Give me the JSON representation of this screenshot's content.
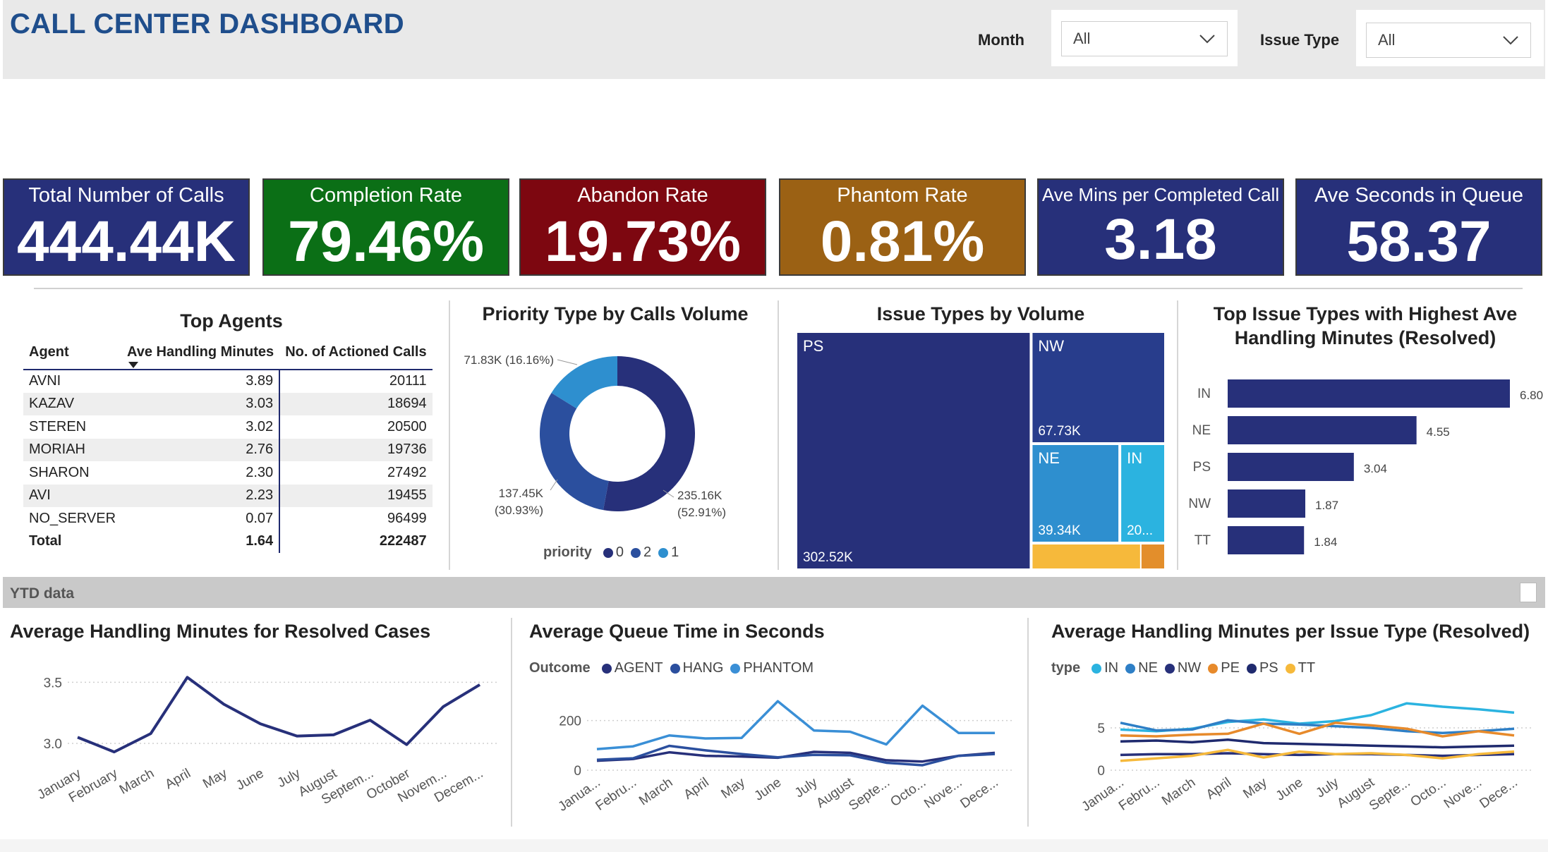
{
  "header": {
    "title": "CALL CENTER DASHBOARD",
    "filters": [
      {
        "label": "Month",
        "value": "All"
      },
      {
        "label": "Issue Type",
        "value": "All"
      }
    ]
  },
  "kpis": [
    {
      "title": "Total Number of Calls",
      "value": "444.44K",
      "color": "#27307a"
    },
    {
      "title": "Completion Rate",
      "value": "79.46%",
      "color": "#0b6f16"
    },
    {
      "title": "Abandon Rate",
      "value": "19.73%",
      "color": "#7d0710"
    },
    {
      "title": "Phantom Rate",
      "value": "0.81%",
      "color": "#9b6114"
    },
    {
      "title": "Ave Mins per Completed Call",
      "value": "3.18",
      "color": "#27307a"
    },
    {
      "title": "Ave Seconds in Queue",
      "value": "58.37",
      "color": "#27307a"
    }
  ],
  "top_agents": {
    "title": "Top Agents",
    "columns": [
      "Agent",
      "Ave Handling Minutes",
      "No. of Actioned Calls"
    ],
    "rows": [
      [
        "AVNI",
        "3.89",
        "20111"
      ],
      [
        "KAZAV",
        "3.03",
        "18694"
      ],
      [
        "STEREN",
        "3.02",
        "20500"
      ],
      [
        "MORIAH",
        "2.76",
        "19736"
      ],
      [
        "SHARON",
        "2.30",
        "27492"
      ],
      [
        "AVI",
        "2.23",
        "19455"
      ],
      [
        "NO_SERVER",
        "0.07",
        "96499"
      ]
    ],
    "total": [
      "Total",
      "1.64",
      "222487"
    ]
  },
  "ytd_label": "YTD data",
  "chart_data": [
    {
      "id": "priority",
      "type": "pie",
      "title": "Priority Type by Calls Volume",
      "legend_title": "priority",
      "slices": [
        {
          "name": "0",
          "value": 235.16,
          "label": "235.16K",
          "pct": "(52.91%)",
          "color": "#27307a"
        },
        {
          "name": "2",
          "value": 137.45,
          "label": "137.45K",
          "pct": "(30.93%)",
          "color": "#2b4f9e"
        },
        {
          "name": "1",
          "value": 71.83,
          "label": "71.83K (16.16%)",
          "pct": "",
          "color": "#2e8fcf"
        }
      ]
    },
    {
      "id": "issue_treemap",
      "type": "treemap",
      "title": "Issue Types by Volume",
      "items": [
        {
          "name": "PS",
          "value": 302.52,
          "label": "302.52K",
          "color": "#27307a"
        },
        {
          "name": "NW",
          "value": 67.73,
          "label": "67.73K",
          "color": "#283d8c"
        },
        {
          "name": "NE",
          "value": 39.34,
          "label": "39.34K",
          "color": "#2e8fcf"
        },
        {
          "name": "IN",
          "value": 20.0,
          "label": "20...",
          "color": "#2bb3e0"
        },
        {
          "name": "PE",
          "value": 12.0,
          "label": "",
          "color": "#f6b93b"
        },
        {
          "name": "TT",
          "value": 2.5,
          "label": "",
          "color": "#e38e2b"
        }
      ]
    },
    {
      "id": "top_issue_aht",
      "type": "bar",
      "orientation": "horizontal",
      "title": "Top Issue Types with Highest Ave Handling Minutes (Resolved)",
      "categories": [
        "IN",
        "NE",
        "PS",
        "NW",
        "TT"
      ],
      "values": [
        6.8,
        4.55,
        3.04,
        1.87,
        1.84
      ],
      "value_labels": [
        "6.80",
        "4.55",
        "3.04",
        "1.87",
        "1.84"
      ],
      "xlim": [
        0,
        6.8
      ],
      "color": "#27307a"
    },
    {
      "id": "aht_resolved",
      "type": "line",
      "title": "Average Handling Minutes for Resolved Cases",
      "categories": [
        "January",
        "February",
        "March",
        "April",
        "May",
        "June",
        "July",
        "August",
        "Septem...",
        "October",
        "Novem...",
        "Decem..."
      ],
      "series": [
        {
          "values": [
            3.05,
            2.93,
            3.08,
            3.54,
            3.32,
            3.16,
            3.06,
            3.07,
            3.19,
            2.99,
            3.3,
            3.48
          ],
          "color": "#27307a"
        }
      ],
      "yticks": [
        "3.0",
        "3.5"
      ],
      "ylim": [
        2.85,
        3.6
      ]
    },
    {
      "id": "queue_time",
      "type": "line",
      "title": "Average Queue Time in Seconds",
      "legend_title": "Outcome",
      "categories": [
        "Janua...",
        "Febru...",
        "March",
        "April",
        "May",
        "June",
        "July",
        "August",
        "Septe...",
        "Octo...",
        "Nove...",
        "Dece..."
      ],
      "series": [
        {
          "name": "AGENT",
          "values": [
            38,
            45,
            72,
            58,
            55,
            50,
            74,
            70,
            40,
            35,
            58,
            70
          ],
          "color": "#27307a"
        },
        {
          "name": "HANG",
          "values": [
            42,
            48,
            98,
            80,
            65,
            52,
            62,
            60,
            30,
            20,
            58,
            65
          ],
          "color": "#2b4f9e"
        },
        {
          "name": "PHANTOM",
          "values": [
            85,
            96,
            140,
            128,
            130,
            278,
            160,
            155,
            104,
            260,
            150,
            150
          ],
          "color": "#3a8fd6"
        }
      ],
      "yticks": [
        "0",
        "200"
      ],
      "ylim": [
        0,
        290
      ]
    },
    {
      "id": "aht_issue_type",
      "type": "line",
      "title": "Average Handling Minutes per Issue Type (Resolved)",
      "legend_title": "type",
      "categories": [
        "Janua...",
        "Febru...",
        "March",
        "April",
        "May",
        "June",
        "July",
        "August",
        "Septe...",
        "Octo...",
        "Nove...",
        "Dece..."
      ],
      "series": [
        {
          "name": "IN",
          "values": [
            4.8,
            4.6,
            4.9,
            5.7,
            6.0,
            5.5,
            5.8,
            6.5,
            7.9,
            7.5,
            7.2,
            6.8
          ],
          "color": "#2bb3e0"
        },
        {
          "name": "NE",
          "values": [
            5.6,
            4.7,
            4.8,
            5.9,
            5.5,
            5.4,
            5.2,
            5.0,
            4.6,
            4.4,
            4.6,
            4.9
          ],
          "color": "#2e7fc6"
        },
        {
          "name": "NW",
          "values": [
            1.8,
            1.9,
            1.9,
            2.0,
            1.9,
            1.8,
            1.9,
            1.9,
            1.8,
            1.7,
            1.8,
            1.9
          ],
          "color": "#27307a"
        },
        {
          "name": "PE",
          "values": [
            4.1,
            4.0,
            4.2,
            4.3,
            5.5,
            4.3,
            5.6,
            5.3,
            4.9,
            4.0,
            4.6,
            4.1
          ],
          "color": "#e78a2b"
        },
        {
          "name": "PS",
          "values": [
            3.4,
            3.5,
            3.3,
            3.6,
            3.2,
            3.1,
            3.0,
            2.9,
            2.8,
            2.7,
            2.8,
            2.9
          ],
          "color": "#1f2a6e"
        },
        {
          "name": "TT",
          "values": [
            1.1,
            1.4,
            1.7,
            2.4,
            1.5,
            2.2,
            1.9,
            2.0,
            1.8,
            1.4,
            1.9,
            2.2
          ],
          "color": "#f6b93b"
        }
      ],
      "yticks": [
        "0",
        "5"
      ],
      "ylim": [
        0,
        8.5
      ]
    }
  ]
}
